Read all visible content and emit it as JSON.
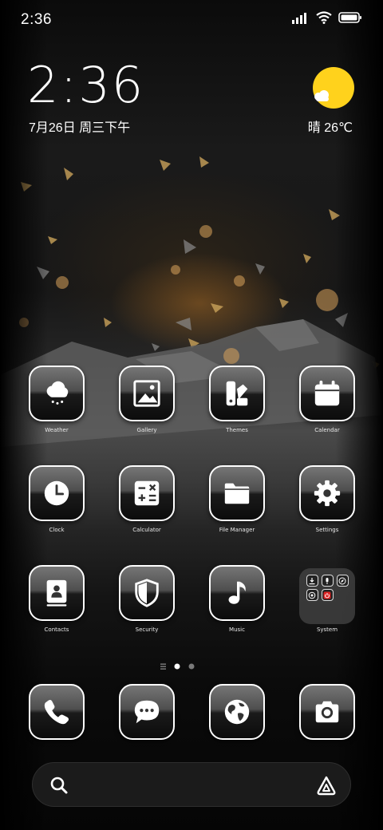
{
  "status_bar": {
    "time": "2:36",
    "icons": [
      "signal-icon",
      "wifi-icon",
      "battery-icon"
    ]
  },
  "clock_widget": {
    "time": "2:36",
    "date": "7月26日 周三下午"
  },
  "weather_widget": {
    "condition": "晴",
    "temperature": "26℃",
    "icon": "sunny-icon"
  },
  "apps": [
    {
      "label": "Weather",
      "icon": "weather-icon"
    },
    {
      "label": "Gallery",
      "icon": "gallery-icon"
    },
    {
      "label": "Themes",
      "icon": "themes-icon"
    },
    {
      "label": "Calendar",
      "icon": "calendar-icon"
    },
    {
      "label": "Clock",
      "icon": "clock-icon"
    },
    {
      "label": "Calculator",
      "icon": "calculator-icon"
    },
    {
      "label": "File Manager",
      "icon": "folder-icon"
    },
    {
      "label": "Settings",
      "icon": "gear-icon"
    },
    {
      "label": "Contacts",
      "icon": "contacts-icon"
    },
    {
      "label": "Security",
      "icon": "shield-icon"
    },
    {
      "label": "Music",
      "icon": "music-note-icon"
    },
    {
      "label": "System",
      "icon": "folder-icon"
    }
  ],
  "system_folder_icons": [
    "download-icon",
    "microphone-icon",
    "compass-icon",
    "scanner-icon",
    "power-icon"
  ],
  "page_indicator": {
    "pages": 2,
    "current": 1
  },
  "dock": [
    {
      "icon": "phone-icon"
    },
    {
      "icon": "messages-icon"
    },
    {
      "icon": "browser-globe-icon"
    },
    {
      "icon": "camera-icon"
    }
  ],
  "search_bar": {
    "icons": [
      "search-icon",
      "assistant-icon"
    ]
  },
  "colors": {
    "sun": "#ffd21c",
    "tile_border": "#ffffff",
    "background": "#000000"
  }
}
